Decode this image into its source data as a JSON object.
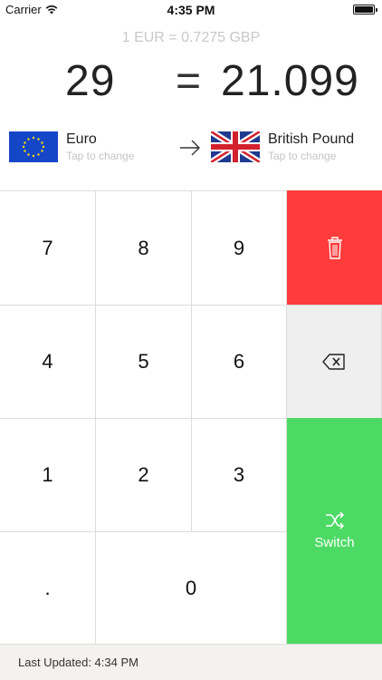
{
  "status_bar": {
    "carrier": "Carrier",
    "time": "4:35 PM"
  },
  "rate_text": "1 EUR = 0.7275 GBP",
  "amounts": {
    "from": "29",
    "equals": "=",
    "to": "21.099"
  },
  "currency_from": {
    "name": "Euro",
    "hint": "Tap to change"
  },
  "currency_to": {
    "name": "British Pound",
    "hint": "Tap to change"
  },
  "keys": {
    "k7": "7",
    "k8": "8",
    "k9": "9",
    "k4": "4",
    "k5": "5",
    "k6": "6",
    "k1": "1",
    "k2": "2",
    "k3": "3",
    "kdot": ".",
    "k0": "0"
  },
  "switch_label": "Switch",
  "footer": {
    "last_updated": "Last Updated: 4:34 PM"
  },
  "colors": {
    "delete": "#ff3b3b",
    "backspace": "#efefef",
    "switch": "#4cd964"
  }
}
